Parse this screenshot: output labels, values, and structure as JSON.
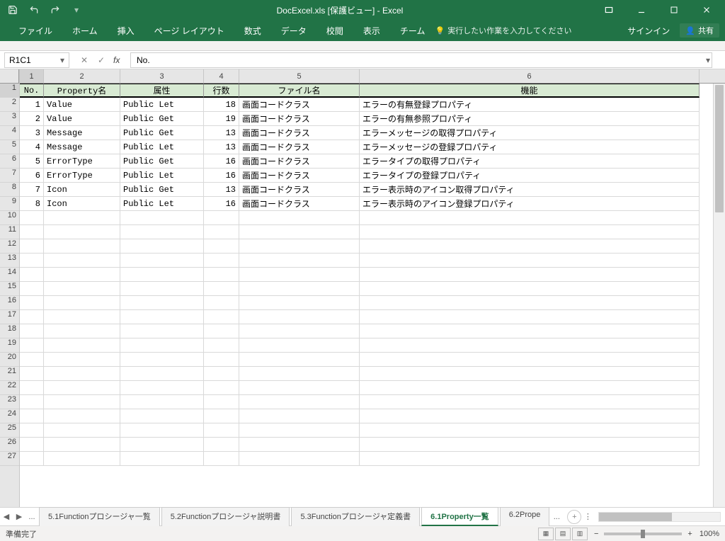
{
  "titlebar": {
    "title": "DocExcel.xls  [保護ビュー]  -  Excel"
  },
  "ribbon": {
    "tabs": [
      "ファイル",
      "ホーム",
      "挿入",
      "ページ レイアウト",
      "数式",
      "データ",
      "校閲",
      "表示",
      "チーム"
    ],
    "tellme": "実行したい作業を入力してください",
    "signin": "サインイン",
    "share": "共有"
  },
  "namebox": "R1C1",
  "formula": "No.",
  "columns": [
    "1",
    "2",
    "3",
    "4",
    "5",
    "6"
  ],
  "row_headers": [
    "1",
    "2",
    "3",
    "4",
    "5",
    "6",
    "7",
    "8",
    "9",
    "10",
    "11",
    "12",
    "13",
    "14",
    "15",
    "16",
    "17",
    "18",
    "19",
    "20",
    "21",
    "22",
    "23",
    "24",
    "25",
    "26",
    "27"
  ],
  "header_row": [
    "No.",
    "Property名",
    "属性",
    "行数",
    "ファイル名",
    "機能"
  ],
  "data_rows": [
    [
      "1",
      "Value",
      "Public Let",
      "18",
      "画面コードクラス",
      "エラーの有無登録プロパティ"
    ],
    [
      "2",
      "Value",
      "Public Get",
      "19",
      "画面コードクラス",
      "エラーの有無参照プロパティ"
    ],
    [
      "3",
      "Message",
      "Public Get",
      "13",
      "画面コードクラス",
      "エラーメッセージの取得プロパティ"
    ],
    [
      "4",
      "Message",
      "Public Let",
      "13",
      "画面コードクラス",
      "エラーメッセージの登録プロパティ"
    ],
    [
      "5",
      "ErrorType",
      "Public Get",
      "16",
      "画面コードクラス",
      "エラータイプの取得プロパティ"
    ],
    [
      "6",
      "ErrorType",
      "Public Let",
      "16",
      "画面コードクラス",
      "エラータイプの登録プロパティ"
    ],
    [
      "7",
      "Icon",
      "Public Get",
      "13",
      "画面コードクラス",
      "エラー表示時のアイコン取得プロパティ"
    ],
    [
      "8",
      "Icon",
      "Public Let",
      "16",
      "画面コードクラス",
      "エラー表示時のアイコン登録プロパティ"
    ]
  ],
  "sheet_tabs": {
    "items": [
      "5.1Functionプロシージャ一覧",
      "5.2Functionプロシージャ説明書",
      "5.3Functionプロシージャ定義書",
      "6.1Property一覧",
      "6.2Prope"
    ],
    "active_index": 3,
    "ellipsis": "..."
  },
  "statusbar": {
    "ready": "準備完了",
    "zoom": "100%",
    "minus": "−",
    "plus": "+"
  }
}
